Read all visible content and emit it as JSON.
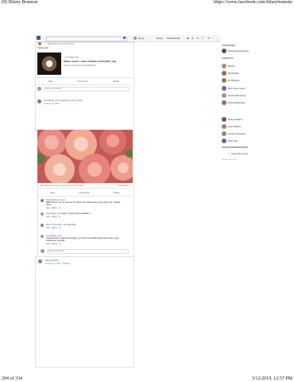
{
  "print_header": {
    "left": "(8) Hilary Branson",
    "right": "https://www.facebook.com/hilarybranske"
  },
  "print_footer": {
    "left": "294 of 334",
    "right": "3/12/2019, 12:57 PM"
  },
  "topbar": {
    "search_placeholder": "",
    "user_name": "Greg",
    "nav_home": "Home",
    "nav_find_friends": "Find Friends"
  },
  "post1": {
    "header_text": "Hilary Branson shared a link",
    "caption": "Today loved",
    "link_domain": "YOUTUBE.COM",
    "link_title": "Sanity sound – mite of Beatles (& English mix)",
    "link_desc": "https://en.wikipedia.org/wiki/Beatles",
    "like": "Like",
    "comment": "Comment",
    "share": "Share",
    "write_comment": "Write a comment..."
  },
  "post2": {
    "author": "Lisa Weaer Lune updated her cover photo.",
    "date": "February 5, 2019",
    "reactions": "Hilary Branson, Dolo Cuero Ahler, B and 3 others",
    "comments_count": "4 Comments",
    "like": "Like",
    "comment": "Comment",
    "share": "Share",
    "comments": [
      {
        "author": "Ruth E Dance Guuro",
        "text": "BEAUTIFUL. Are so stunned for colour and LIFE beauty, about right now. Thanks, thank",
        "meta": "Like · Reply · 1y"
      },
      {
        "author": "Lisa Weaer Lune",
        "text": "hold.. it's just yeahn available ?",
        "meta": "Like · Reply · 1y"
      },
      {
        "author": "Dolo Cuero Ahler",
        "text": "in a new thus",
        "meta": "Like · Reply · 1y"
      },
      {
        "author": "Lisa Weaer Lune",
        "text": "Thanks bella !! Gals this will happy 'cyt' and 2 of lovable friends friend the mega shades are yolk light",
        "meta": "Like · Reply · 1y"
      }
    ],
    "write_comment": "Write a comment..."
  },
  "post3": {
    "author": "Hilary Branson",
    "date": "February 5, 2019 · Bollabo"
  },
  "sidebar": {
    "your_pages_title": "YOUR PAGES",
    "page_item": "Ostoudbury/Legendary",
    "contacts_title": "CONTACTS",
    "contacts": [
      "Bill Pax",
      "Bob Bradley",
      "lily Wrdentar",
      "Mary Louse Lagon",
      "Sarah Natlif Harvey",
      "Shure Roliprophac"
    ],
    "contacts2": [
      "Betsy Heitkamp",
      "Duan Wiltsher",
      "Jennifer Sassymon",
      "Sherri Hay"
    ],
    "group_title": "GROUP CONVERSATIONS",
    "create_group": "Create New Group",
    "small_note": "Search contacts etc."
  }
}
